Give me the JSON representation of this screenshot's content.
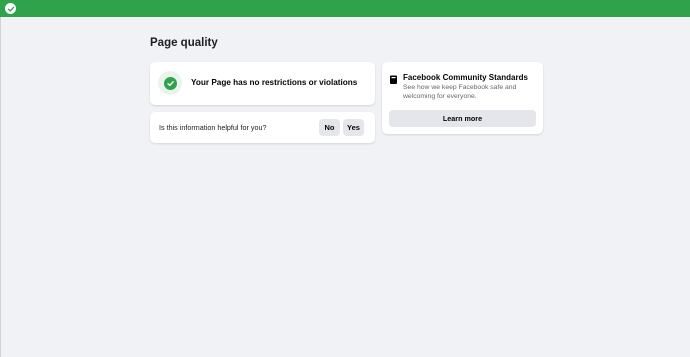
{
  "topbar": {
    "icon": "check-circle-icon",
    "color": "#31a24c"
  },
  "page": {
    "title": "Page quality"
  },
  "status": {
    "icon": "check-circle-icon",
    "message": "Your Page has no restrictions or violations",
    "color": "#31a24c"
  },
  "feedback": {
    "question": "Is this information helpful for you?",
    "no_label": "No",
    "yes_label": "Yes"
  },
  "community_standards": {
    "icon": "book-icon",
    "title": "Facebook Community Standards",
    "description": "See how we keep Facebook safe and welcoming for everyone.",
    "button_label": "Learn more"
  }
}
